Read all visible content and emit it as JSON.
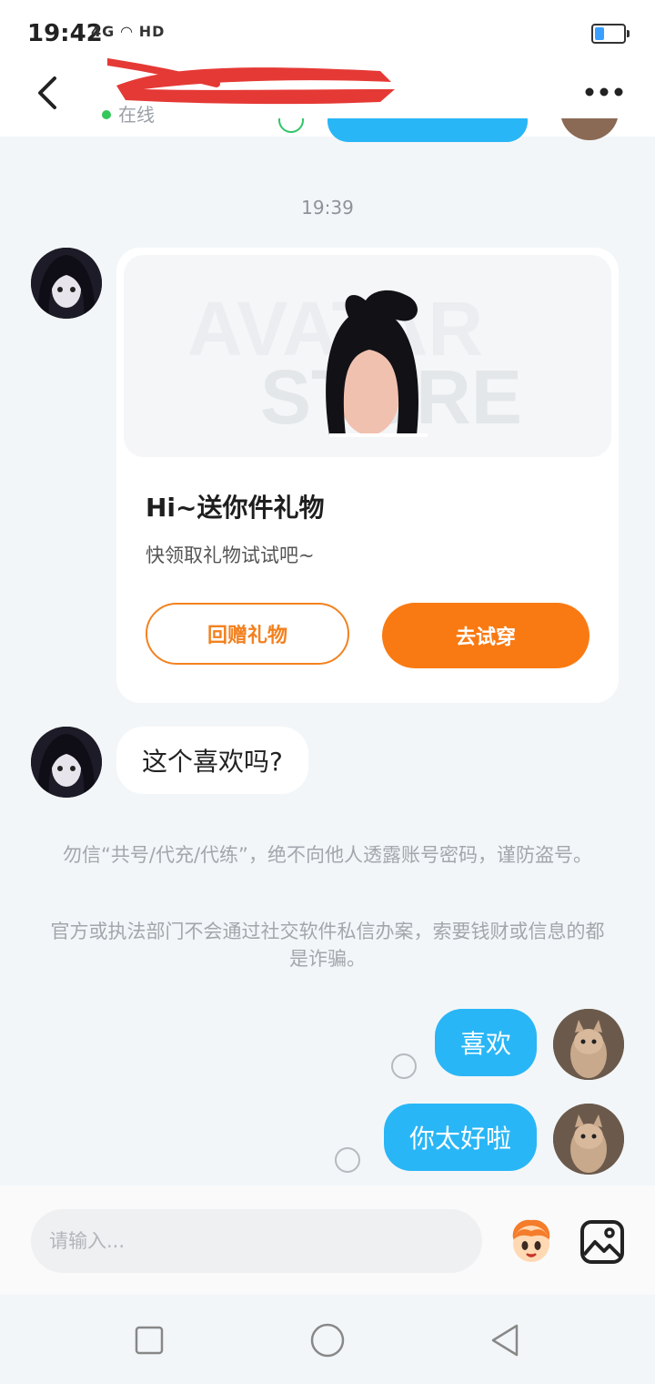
{
  "status_bar": {
    "time": "19:42",
    "signal_text": "4G",
    "hd_text": "HD"
  },
  "header": {
    "presence": "在线"
  },
  "chat": {
    "timestamp": "19:39",
    "gift_card": {
      "title": "Hi~送你件礼物",
      "subtitle": "快领取礼物试试吧~",
      "return_button": "回赠礼物",
      "try_button": "去试穿"
    },
    "incoming_message": "这个喜欢吗?",
    "notice_1": "勿信“共号/代充/代练”，绝不向他人透露账号密码，谨防盗号。",
    "notice_2": "官方或执法部门不会通过社交软件私信办案，索要钱财或信息的都是诈骗。",
    "outgoing_1": "喜欢",
    "outgoing_2": "你太好啦"
  },
  "composer": {
    "placeholder": "请输入..."
  },
  "icons": [
    "back-icon",
    "more-icon",
    "emoji-icon",
    "image-icon",
    "recent-apps-icon",
    "home-icon",
    "nav-back-icon"
  ],
  "colors": {
    "accent_blue": "#29b6f6",
    "accent_orange": "#f97a12",
    "online_green": "#35c759"
  }
}
